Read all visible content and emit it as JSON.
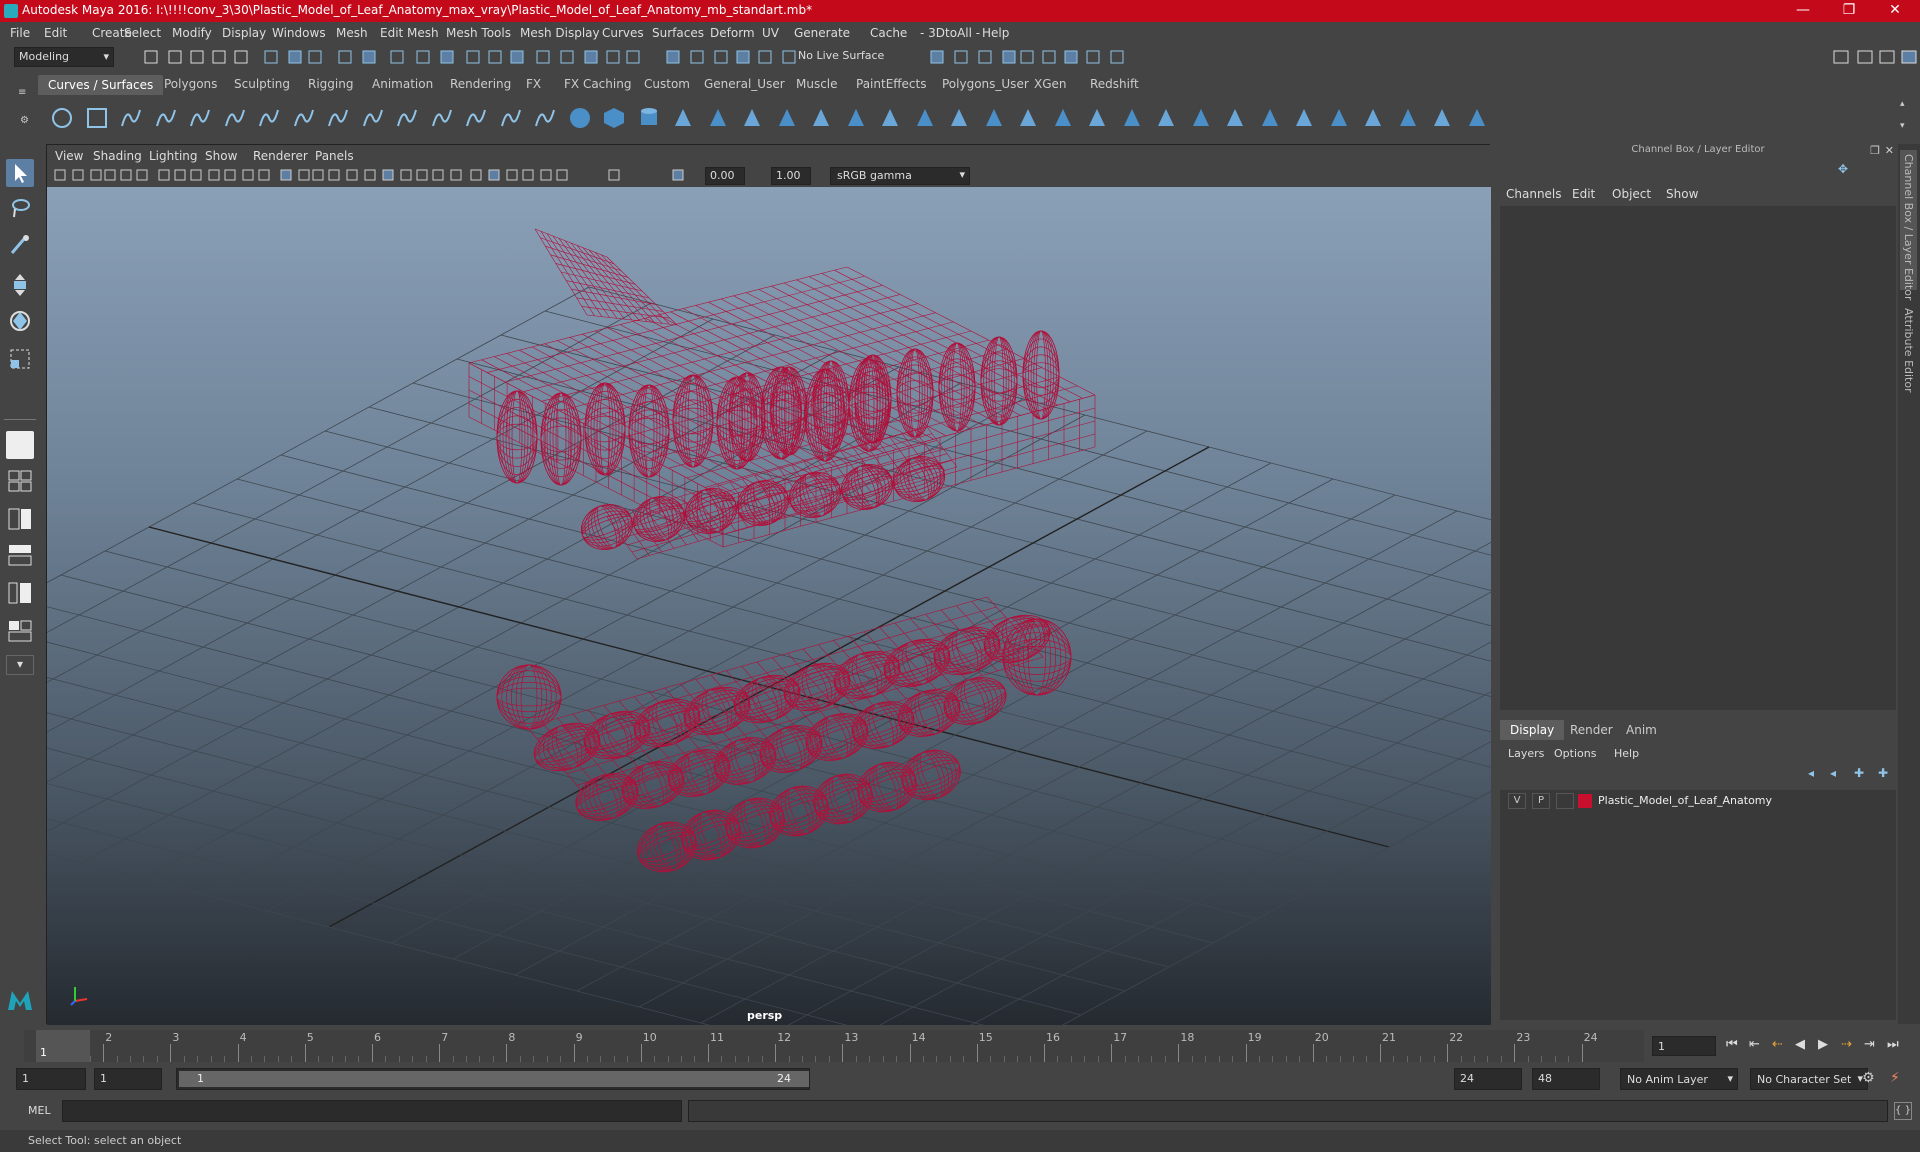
{
  "app": {
    "title": "Autodesk Maya 2016: I:\\!!!!conv_3\\30\\Plastic_Model_of_Leaf_Anatomy_max_vray\\Plastic_Model_of_Leaf_Anatomy_mb_standart.mb*",
    "window_buttons": [
      "—",
      "❐",
      "✕"
    ]
  },
  "menubar": [
    "File",
    "Edit",
    "Create",
    "Select",
    "Modify",
    "Display",
    "Windows",
    "Mesh",
    "Edit Mesh",
    "Mesh Tools",
    "Mesh Display",
    "Curves",
    "Surfaces",
    "Deform",
    "UV",
    "Generate",
    "Cache",
    "- 3DtoAll -",
    "Help"
  ],
  "toolbar": {
    "mode": "Modeling",
    "live_surface": "No Live Surface"
  },
  "shelf_tabs": [
    "Curves / Surfaces",
    "Polygons",
    "Sculpting",
    "Rigging",
    "Animation",
    "Rendering",
    "FX",
    "FX Caching",
    "Custom",
    "General_User",
    "Muscle",
    "PaintEffects",
    "Polygons_User",
    "XGen",
    "Redshift"
  ],
  "viewport": {
    "menus": [
      "View",
      "Shading",
      "Lighting",
      "Show",
      "Renderer",
      "Panels"
    ],
    "exposure": "0.00",
    "gamma": "1.00",
    "colorspace": "sRGB gamma",
    "camera": "persp",
    "wire_color": "#b0103a"
  },
  "right_panel": {
    "title": "Channel Box / Layer Editor",
    "menus": [
      "Channels",
      "Edit",
      "Object",
      "Show"
    ],
    "tabs": [
      "Display",
      "Render",
      "Anim"
    ],
    "layer_menus": [
      "Layers",
      "Options",
      "Help"
    ],
    "layer": {
      "v": "V",
      "p": "P",
      "name": "Plastic_Model_of_Leaf_Anatomy",
      "color": "#c8102e"
    },
    "side_tabs": [
      "Channel Box / Layer Editor",
      "Attribute Editor"
    ]
  },
  "timeline": {
    "ticks": [
      "1",
      "2",
      "3",
      "4",
      "5",
      "6",
      "7",
      "8",
      "9",
      "10",
      "11",
      "12",
      "13",
      "14",
      "15",
      "16",
      "17",
      "18",
      "19",
      "20",
      "21",
      "22",
      "23",
      "24"
    ],
    "current": "1",
    "current_field": "1"
  },
  "range": {
    "start": "1",
    "start2": "1",
    "slider_start": "1",
    "slider_end": "24",
    "end": "24",
    "end2": "48",
    "anim_layer": "No Anim Layer",
    "char_set": "No Character Set"
  },
  "cmd": {
    "lang": "MEL"
  },
  "status": "Select Tool: select an object"
}
